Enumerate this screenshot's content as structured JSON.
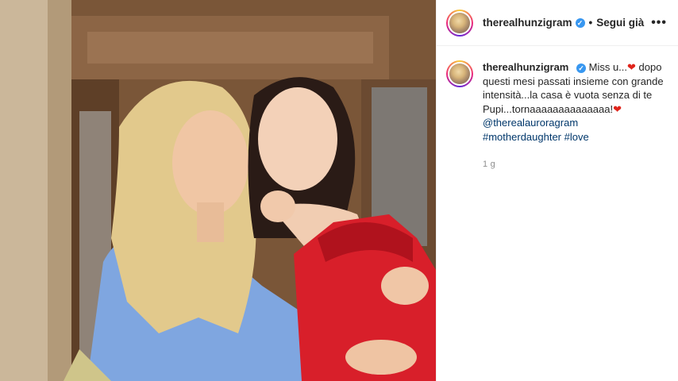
{
  "post": {
    "username": "therealhunzigram",
    "follow_status": "Segui già",
    "separator": "•",
    "more": "•••"
  },
  "caption": {
    "username": "therealhunzigram",
    "text_1": "Miss u...",
    "heart": "❤",
    "text_2": " dopo questi mesi passati insieme con grande intensità...la casa è vuota senza di te Pupi...tornaaaaaaaaaaaaaa!",
    "mention": "@therealauroragram",
    "hashtag_1": "#motherdaughter",
    "hashtag_2": "#love"
  },
  "time": "1 g",
  "photo": {
    "description_icon": "photo-of-two-women-hugging"
  },
  "colors": {
    "verified": "#3897f0",
    "link": "#00376b",
    "heart": "#e0241b",
    "timestamp": "#8e8e8e"
  }
}
